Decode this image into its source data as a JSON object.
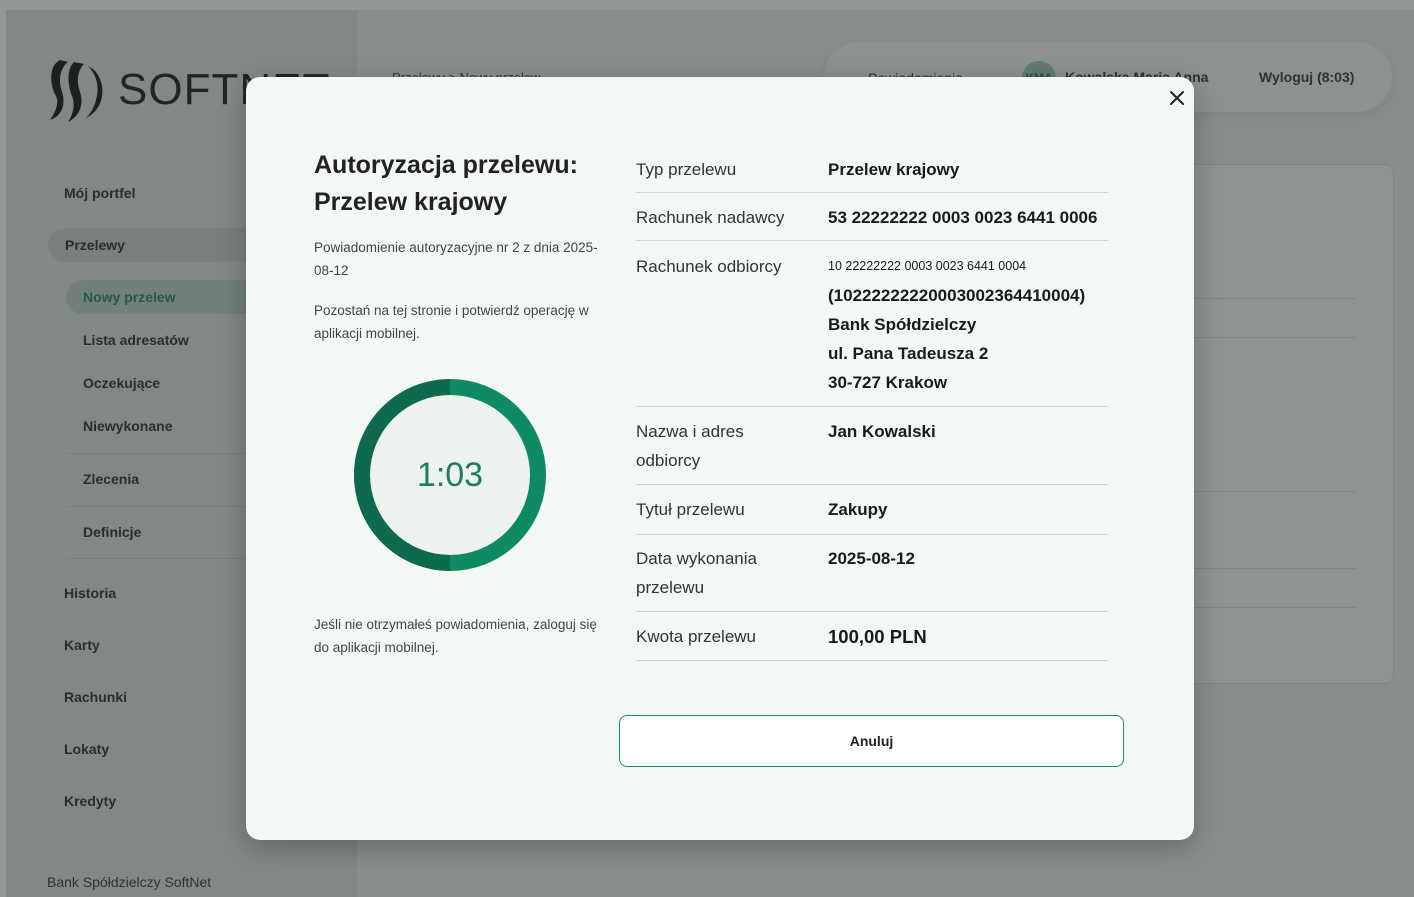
{
  "app": {
    "logo_text": "SOFTNET",
    "breadcrumb": "Przelewy > Nowy przelew",
    "notifications_label": "Powiadomienia",
    "user_initials": "KMA",
    "user_name": "Kowalska Maria Anna",
    "logout_label": "Wyloguj (8:03)",
    "footer": "Bank Spółdzielczy SoftNet"
  },
  "sidebar": {
    "items": [
      {
        "label": "Mój portfel"
      },
      {
        "label": "Przelewy"
      },
      {
        "label": "Historia"
      },
      {
        "label": "Karty"
      },
      {
        "label": "Rachunki"
      },
      {
        "label": "Lokaty"
      },
      {
        "label": "Kredyty"
      }
    ],
    "sub_items": [
      {
        "label": "Nowy przelew"
      },
      {
        "label": "Lista adresatów"
      },
      {
        "label": "Oczekujące"
      },
      {
        "label": "Niewykonane"
      },
      {
        "label": "Zlecenia"
      },
      {
        "label": "Definicje"
      }
    ]
  },
  "modal": {
    "title_line1": "Autoryzacja przelewu:",
    "title_line2": "Przelew krajowy",
    "notification_info": "Powiadomienie autoryzacyjne nr 2 z dnia 2025-08-12",
    "stay_info": "Pozostań na tej stronie i potwierdź operację w aplikacji mobilnej.",
    "timer": "1:03",
    "timer_progress": 0.95,
    "fallback_info": "Jeśli nie otrzymałeś powiadomienia, zaloguj się do aplikacji mobilnej.",
    "cancel_label": "Anuluj",
    "accent_color": "#1e7d5c",
    "details": {
      "type_label": "Typ przelewu",
      "type_value": "Przelew krajowy",
      "sender_label": "Rachunek nadawcy",
      "sender_value": "53 22222222 0003 0023 6441 0006",
      "recipient_label": "Rachunek odbiorcy",
      "recipient_account": "10 22222222 0003 0023 6441 0004",
      "recipient_account_raw": "(10222222220003002364410004)",
      "recipient_bank": "Bank Spółdzielczy",
      "recipient_street": "ul. Pana Tadeusza 2",
      "recipient_city": "30-727 Krakow",
      "name_label_line1": "Nazwa i adres",
      "name_label_line2": "odbiorcy",
      "name_value": "Jan Kowalski",
      "title_label": "Tytuł przelewu",
      "title_value": "Zakupy",
      "date_label_line1": "Data wykonania",
      "date_label_line2": "przelewu",
      "date_value": "2025-08-12",
      "amount_label": "Kwota przelewu",
      "amount_value": "100,00 PLN"
    }
  }
}
